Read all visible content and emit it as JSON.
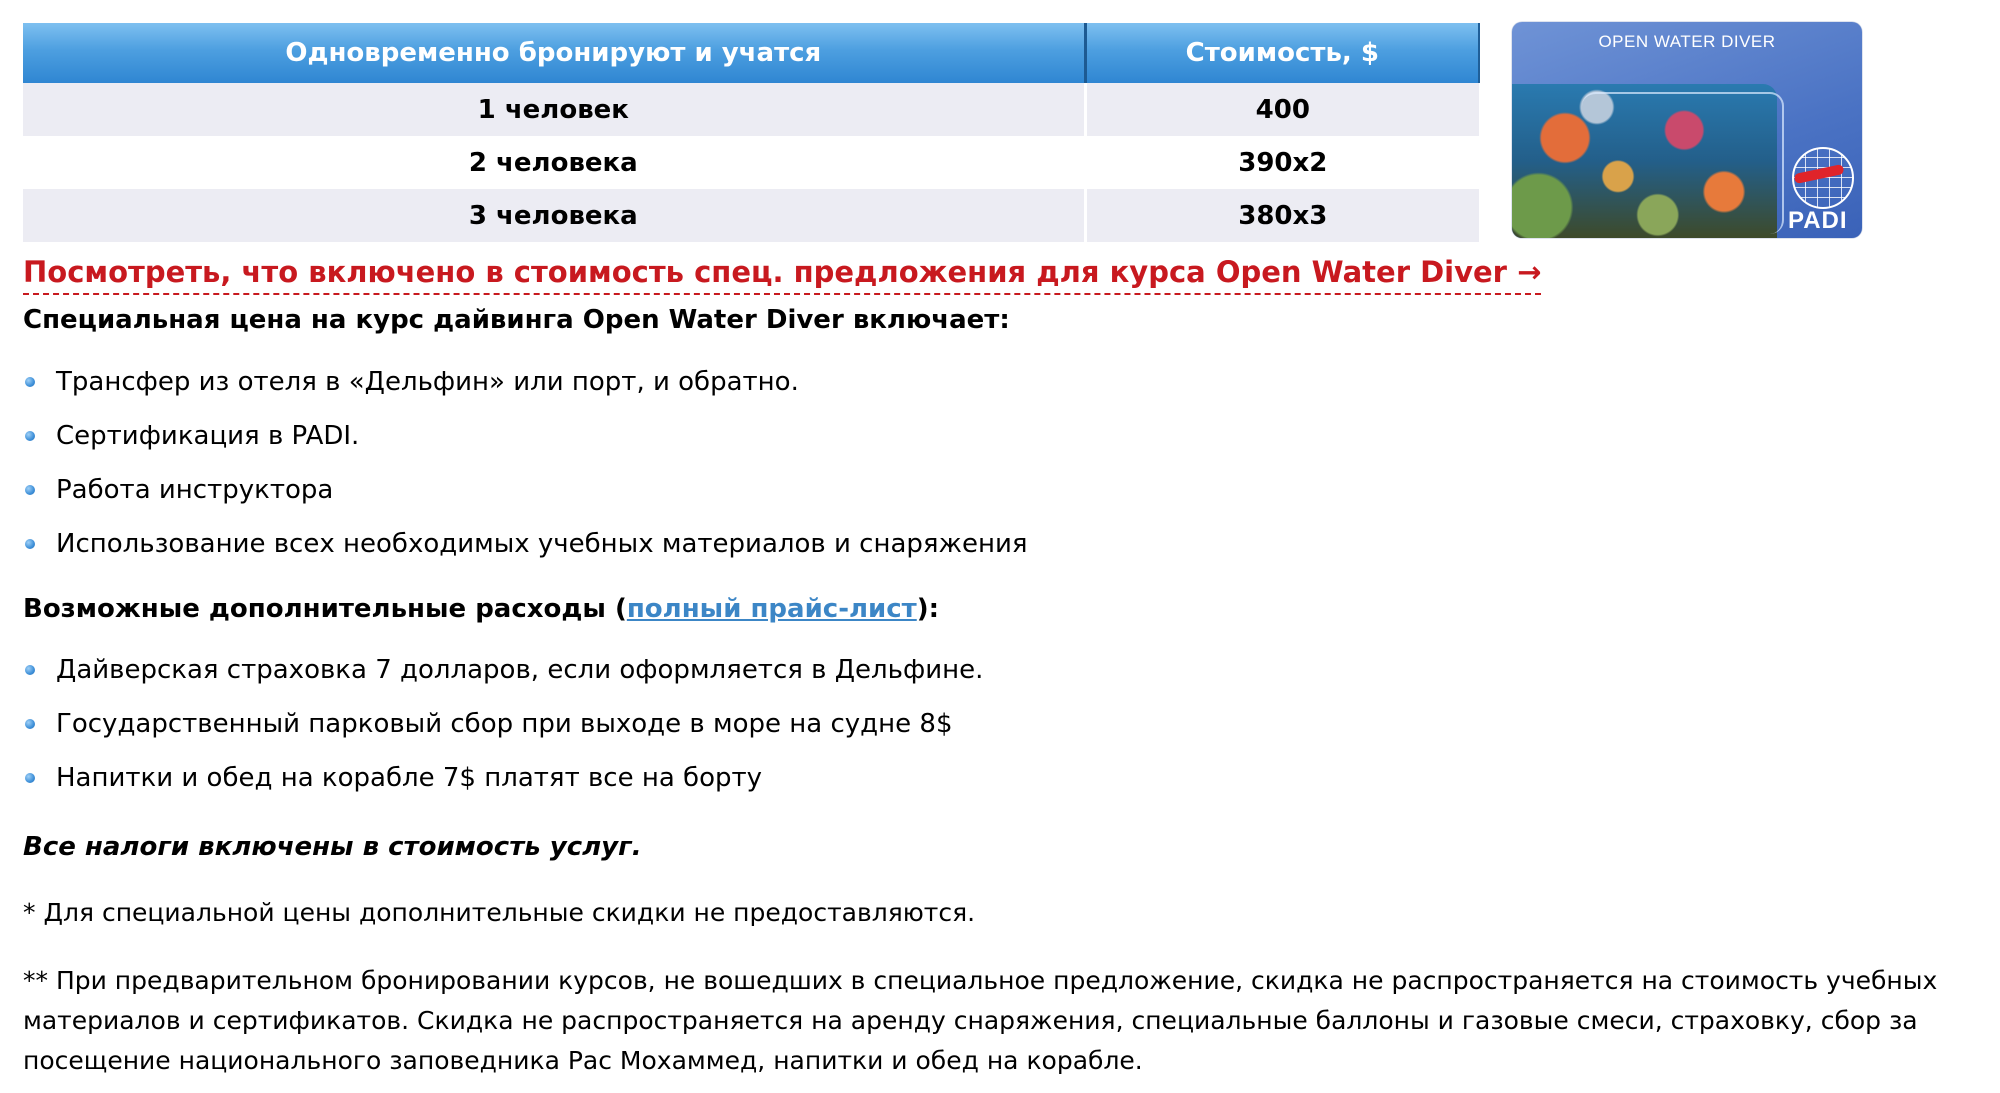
{
  "price_table": {
    "headers": [
      "Одновременно бронируют и учатся",
      "Стоимость, $"
    ],
    "rows": [
      {
        "people": "1 человек",
        "price": "400"
      },
      {
        "people": "2 человека",
        "price": "390x2"
      },
      {
        "people": "3 человека",
        "price": "380x3"
      }
    ]
  },
  "card": {
    "title": "OPEN WATER DIVER",
    "logo": "PADI"
  },
  "offer_link": "Посмотреть, что включено в стоимость спец. предложения для курса Open Water Diver →",
  "includes": {
    "heading": "Специальная цена на курс дайвинга Open Water Diver включает:",
    "items": [
      "Трансфер из отеля в «Дельфин» или порт, и обратно.",
      "Сертификация в PADI.",
      "Работа инструктора",
      "Использование всех необходимых учебных материалов и снаряжения"
    ]
  },
  "extras": {
    "heading_before": "Возможные  дополнительные расходы (",
    "link": "полный прайс-лист",
    "heading_after": "):",
    "items": [
      "Дайверская страховка 7 долларов, если оформляется в Дельфине.",
      "Государственный парковый сбор при выходе в море на судне 8$",
      "Напитки и обед на корабле 7$ платят все на борту"
    ]
  },
  "taxes_note": "Все налоги включены в стоимость услуг.",
  "footnotes": [
    "* Для специальной цены дополнительные скидки не предоставляются.",
    "** При предварительном бронировании курсов, не вошедших в специальное предложение, скидка не распространяется на стоимость учебных материалов и сертификатов. Скидка не распространяется на аренду снаряжения, специальные баллоны и газовые смеси, страховку, сбор за посещение национального заповедника Рас Мохаммед, напитки и обед на корабле."
  ],
  "colors": {
    "header_blue": "#4d9fe0",
    "link_red": "#c8191f",
    "link_blue": "#3c86c6",
    "row_alt": "#ececf3"
  }
}
